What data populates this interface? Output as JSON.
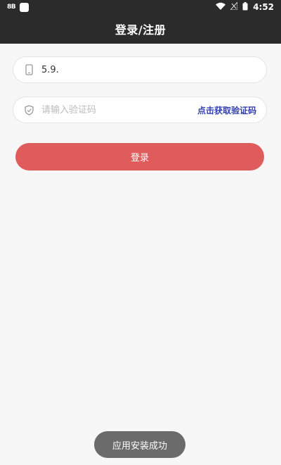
{
  "status_bar": {
    "badge": "8B",
    "time": "4:52"
  },
  "header": {
    "title": "登录/注册"
  },
  "form": {
    "phone": {
      "value": "5.9.",
      "icon": "phone-icon"
    },
    "code": {
      "placeholder": "请输入验证码",
      "icon": "shield-icon",
      "get_code_label": "点击获取验证码"
    },
    "login_label": "登录"
  },
  "toast": {
    "message": "应用安装成功"
  },
  "colors": {
    "header_bg": "#2b2b2b",
    "page_bg": "#f7f7f7",
    "primary": "#e05c5c",
    "link": "#2f3fb0"
  }
}
